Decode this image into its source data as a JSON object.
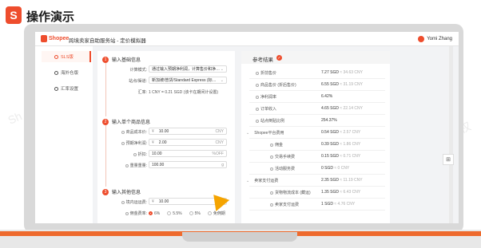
{
  "slide": {
    "logo_letter": "S",
    "title": "操作演示"
  },
  "app": {
    "brand": "Shopee",
    "title": "跨境卖家自助服务站 - 定价模拟器",
    "user": "Yomi Zhang"
  },
  "sidebar": {
    "items": [
      {
        "label": "SLS版",
        "active": true
      },
      {
        "label": "海外仓版",
        "active": false
      },
      {
        "label": "汇率设置",
        "active": false
      }
    ]
  },
  "form": {
    "section1": {
      "num": "1",
      "title": "输入基础信息",
      "calc_mode_label": "计算模式:",
      "calc_mode_value": "通过输入预期净利润，计算售价和净…",
      "channel_label": "站点/渠道:",
      "channel_value": "新加坡/普货/Standard Express (标…",
      "rate_label": "汇率:",
      "rate_value": "1 CNY = 0.21 SGD (该卡在期间计设置)"
    },
    "section2": {
      "num": "2",
      "title": "输入单个商品信息",
      "cost_label": "商品成本价:",
      "cost_prefix": "¥",
      "cost_value": "10.00",
      "cost_suffix": "CNY",
      "profit_label": "预期净利润:",
      "profit_prefix": "¥",
      "profit_value": "2.00",
      "profit_suffix": "CNY",
      "discount_label": "折扣:",
      "discount_value": "10.00",
      "discount_suffix": "%OFF",
      "weight_label": "重量重量:",
      "weight_value": "100.00",
      "weight_suffix": "g"
    },
    "section3": {
      "num": "3",
      "title": "输入其他信息",
      "shipping_label": "境内运运费:",
      "shipping_prefix": "¥",
      "shipping_value": "10.00",
      "shipping_suffix": "CNY",
      "commission_label": "佣金费率:",
      "commission_options": [
        "6%",
        "5.5%",
        "5%",
        "免佣期"
      ]
    }
  },
  "result": {
    "title": "参考结果",
    "rows": [
      {
        "label": "折前售价",
        "value": "7.27 SGD",
        "sub": "≈ 34.63 CNY",
        "indent": false
      },
      {
        "label": "商品售价 (折后售价)",
        "value": "6.55 SGD",
        "sub": "≈ 31.19 CNY",
        "indent": false
      },
      {
        "label": "净利润率",
        "value": "6.42%",
        "sub": "",
        "indent": false
      },
      {
        "label": "订单收入",
        "value": "4.65 SGD",
        "sub": "≈ 22.14 CNY",
        "indent": false
      },
      {
        "label": "站点倒贴比例",
        "value": "254.37%",
        "sub": "",
        "indent": false
      },
      {
        "label": "Shopee平台费用",
        "value": "0.54 SGD",
        "sub": "≈ 2.57 CNY",
        "indent": false,
        "group": true
      },
      {
        "label": "佣金",
        "value": "0.39 SGD",
        "sub": "≈ 1.86 CNY",
        "indent": true
      },
      {
        "label": "交易手续费",
        "value": "0.15 SGD",
        "sub": "≈ 0.71 CNY",
        "indent": true
      },
      {
        "label": "活动服务费",
        "value": "0 SGD",
        "sub": "≈ 0 CNY",
        "indent": true
      },
      {
        "label": "卖家支付运费",
        "value": "2.35 SGD",
        "sub": "≈ 11.19 CNY",
        "indent": false,
        "group": true
      },
      {
        "label": "货物物流成本 (藏运)",
        "value": "1.35 SGD",
        "sub": "≈ 6.43 CNY",
        "indent": true
      },
      {
        "label": "卖家支付运费",
        "value": "1 SGD",
        "sub": "≈ 4.76 CNY",
        "indent": true
      }
    ]
  }
}
